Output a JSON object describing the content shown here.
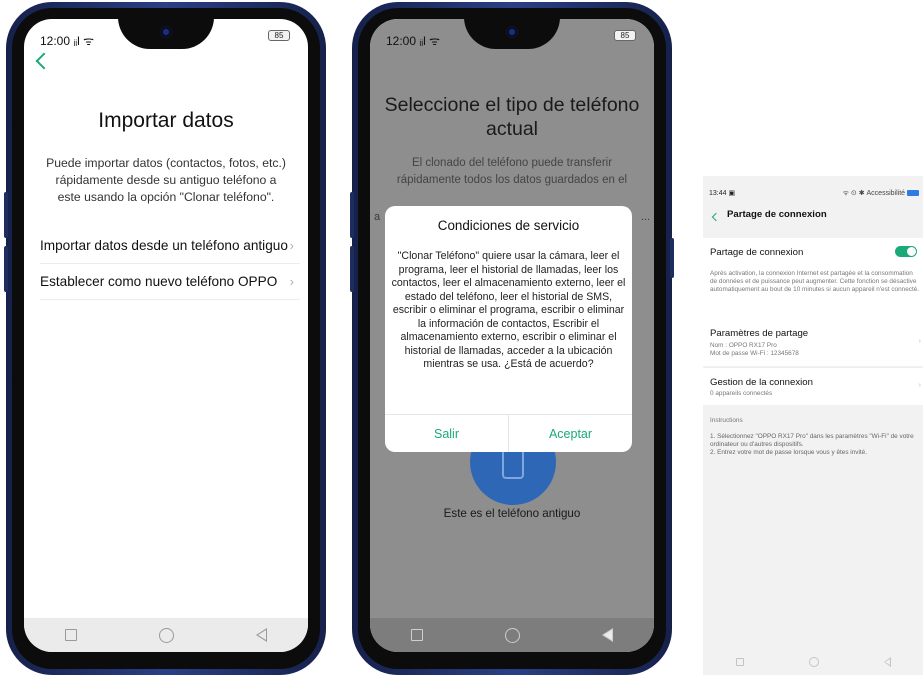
{
  "phone1": {
    "status": {
      "time": "12:00",
      "signal": "ᵢᵢl ᯤ",
      "battery": "85"
    },
    "title": "Importar datos",
    "description": "Puede importar datos (contactos, fotos, etc.) rápidamente desde su antiguo teléfono a este usando la opción \"Clonar teléfono\".",
    "options": [
      {
        "label": "Importar datos desde un teléfono antiguo"
      },
      {
        "label": "Establecer como nuevo teléfono OPPO"
      }
    ],
    "chevron": "›"
  },
  "phone2": {
    "status": {
      "time": "12:00",
      "signal": "ᵢᵢl ᯤ",
      "battery": "85"
    },
    "title": "Seleccione el tipo de teléfono actual",
    "description": "El clonado del teléfono puede transferir rápidamente todos los datos guardados en el",
    "side_left": "a",
    "side_right": "...",
    "caption": "Este es el teléfono antiguo",
    "dialog": {
      "title": "Condiciones de servicio",
      "body": "\"Clonar Teléfono\" quiere usar la cámara, leer el programa, leer el historial de llamadas, leer los contactos, leer el almacenamiento externo, leer el estado del teléfono, leer el historial de SMS, escribir o eliminar el programa, escribir o eliminar la información de contactos, Escribir el almacenamiento externo, escribir o eliminar el historial de llamadas, acceder a la ubicación mientras se usa. ¿Está de acuerdo?",
      "cancel": "Salir",
      "accept": "Aceptar"
    }
  },
  "panel3": {
    "status_time": "13:44",
    "status_icon": "▣",
    "status_right": "ᯤ ⊙ ✱ Accessibilité",
    "header": "Partage de connexion",
    "hotspot_label": "Partage de connexion",
    "hotspot_on": true,
    "hotspot_note": "Après activation, la connexion Internet est partagée et la consommation de données et de puissance peut augmenter. Cette fonction se désactive automatiquement au bout de 10 minutes si aucun appareil n'est connecté.",
    "settings_label": "Paramètres de partage",
    "settings_name": "Nom : OPPO RX17 Pro",
    "settings_password": "Mot de passe Wi-Fi : 12345678",
    "manage_label": "Gestion de la connexion",
    "manage_sub": "0 appareils connectés",
    "instructions_title": "Instructions",
    "instructions_1": "1. Sélectionnez \"OPPO RX17 Pro\" dans les paramètres \"Wi-Fi\" de votre ordinateur ou d'autres dispositifs.",
    "instructions_2": "2. Entrez votre mot de passe lorsque vous y êtes invité.",
    "chevron": "›"
  },
  "colors": {
    "accent": "#1ba97a",
    "frame": "#1f2f6a",
    "dim": "#8e8e8e",
    "circle": "#2f67b7"
  }
}
